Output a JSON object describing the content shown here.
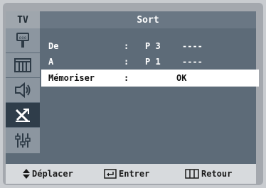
{
  "header": {
    "source": "TV",
    "title": "Sort"
  },
  "menu": {
    "rows": [
      {
        "label": "De",
        "colon": ":",
        "value": "P 3",
        "dashes": "----"
      },
      {
        "label": "A",
        "colon": ":",
        "value": "P 1",
        "dashes": "----"
      },
      {
        "label": "Mémoriser",
        "colon": ":",
        "value": "OK"
      }
    ]
  },
  "sidebar": {
    "items": [
      {
        "icon": "antenna-icon"
      },
      {
        "icon": "screen-icon"
      },
      {
        "icon": "speaker-icon"
      },
      {
        "icon": "satellite-dish-icon",
        "active": true
      },
      {
        "icon": "equalizer-icon"
      }
    ]
  },
  "footer": {
    "move": "Déplacer",
    "enter": "Entrer",
    "back": "Retour"
  }
}
